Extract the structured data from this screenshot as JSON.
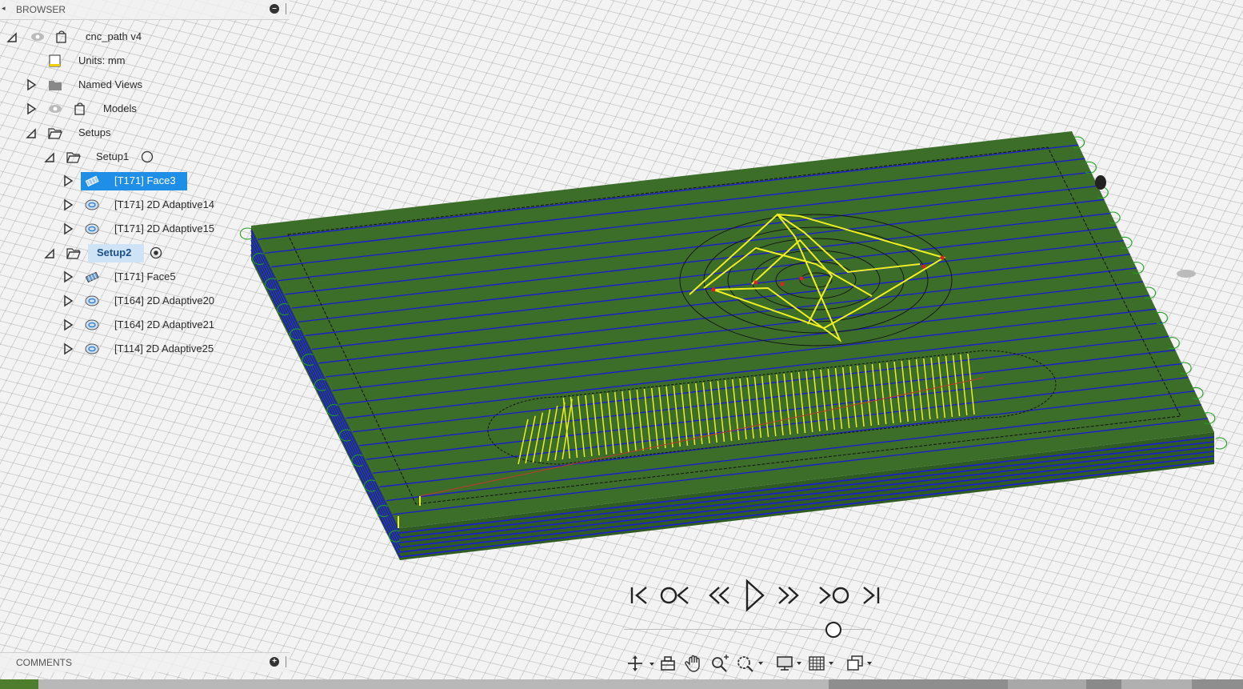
{
  "browser": {
    "title": "BROWSER",
    "tree": [
      {
        "id": "root",
        "label": "cnc_path v4"
      },
      {
        "id": "units",
        "label": "Units: mm"
      },
      {
        "id": "named-views",
        "label": "Named Views"
      },
      {
        "id": "models",
        "label": "Models"
      },
      {
        "id": "setups",
        "label": "Setups"
      },
      {
        "id": "setup1",
        "label": "Setup1"
      },
      {
        "id": "op-face3",
        "label": "[T171] Face3"
      },
      {
        "id": "op-adaptive14",
        "label": "[T171] 2D Adaptive14"
      },
      {
        "id": "op-adaptive15",
        "label": "[T171] 2D Adaptive15"
      },
      {
        "id": "setup2",
        "label": "Setup2"
      },
      {
        "id": "op-face5",
        "label": "[T171] Face5"
      },
      {
        "id": "op-adaptive20",
        "label": "[T164] 2D Adaptive20"
      },
      {
        "id": "op-adaptive21",
        "label": "[T164] 2D Adaptive21"
      },
      {
        "id": "op-adaptive25",
        "label": "[T114] 2D Adaptive25"
      }
    ]
  },
  "comments": {
    "title": "COMMENTS"
  },
  "simulation": {
    "progress": 0.85
  },
  "colors": {
    "stock_top": "#3c6e2a",
    "stock_side": "#2f5c22",
    "toolpath_pass": "#1a1ad6",
    "toolpath_cut": "#f0f020",
    "rapid_move": "#c0392b",
    "selection": "#1f8ee6"
  },
  "icons": {
    "playback": [
      "skip-to-start-icon",
      "previous-operation-icon",
      "step-back-icon",
      "play-icon",
      "step-forward-icon",
      "next-operation-icon",
      "skip-to-end-icon"
    ],
    "navigation": [
      "orbit-icon",
      "look-at-icon",
      "pan-icon",
      "zoom-icon",
      "fit-icon",
      "display-settings-icon",
      "grid-settings-icon",
      "viewports-icon"
    ]
  }
}
